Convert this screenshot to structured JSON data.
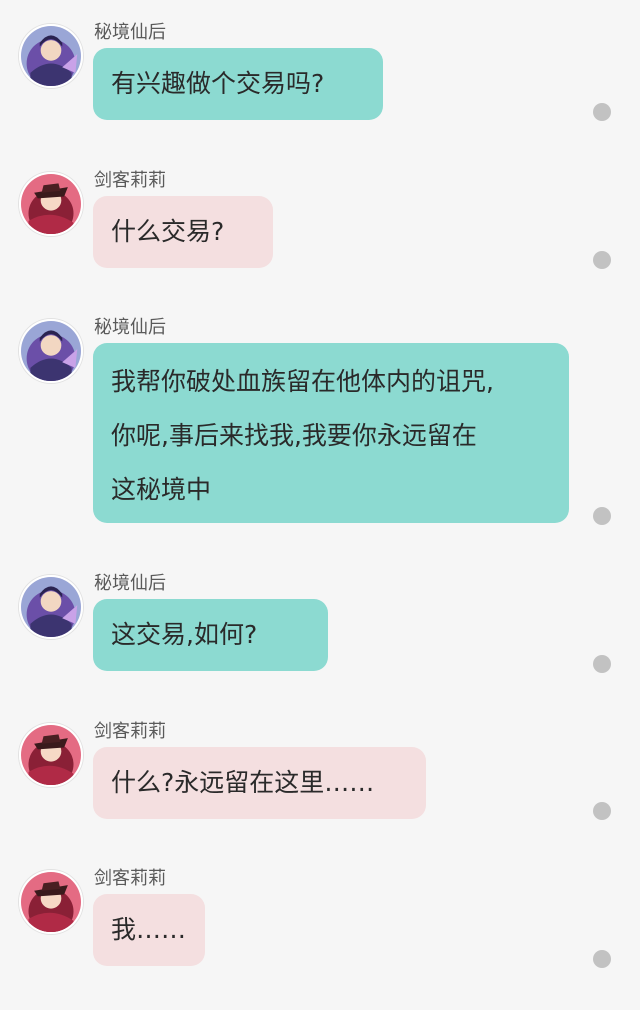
{
  "conversation": {
    "messages": [
      {
        "sender": "秘境仙后",
        "avatar": "queen-avatar",
        "lines": [
          "有兴趣做个交易吗?"
        ]
      },
      {
        "sender": "剑客莉莉",
        "avatar": "lily-avatar",
        "lines": [
          "什么交易?"
        ]
      },
      {
        "sender": "秘境仙后",
        "avatar": "queen-avatar",
        "lines": [
          "我帮你破处血族留在他体内的诅咒,",
          "你呢,事后来找我,我要你永远留在",
          "这秘境中"
        ]
      },
      {
        "sender": "秘境仙后",
        "avatar": "queen-avatar",
        "lines": [
          "这交易,如何?"
        ]
      },
      {
        "sender": "剑客莉莉",
        "avatar": "lily-avatar",
        "lines": [
          "什么?永远留在这里……"
        ]
      },
      {
        "sender": "剑客莉莉",
        "avatar": "lily-avatar",
        "lines": [
          "我……"
        ]
      }
    ]
  },
  "colors": {
    "background": "#f6f6f6",
    "queen_bubble": "#8cdad1",
    "lily_bubble": "#f4dfe0",
    "status_dot": "#c2c2c2"
  }
}
